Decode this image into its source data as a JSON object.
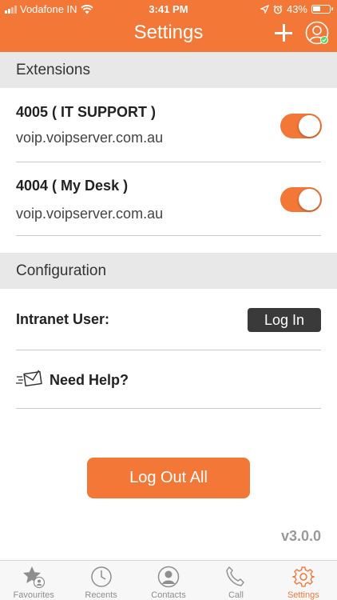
{
  "status_bar": {
    "carrier": "Vodafone IN",
    "time": "3:41 PM",
    "battery": "43%"
  },
  "header": {
    "title": "Settings"
  },
  "extensions": {
    "header": "Extensions",
    "items": [
      {
        "name": "4005 ( IT SUPPORT )",
        "server": "voip.voipserver.com.au",
        "enabled": true
      },
      {
        "name": "4004 ( My Desk )",
        "server": "voip.voipserver.com.au",
        "enabled": true
      }
    ]
  },
  "configuration": {
    "header": "Configuration",
    "intranet_label": "Intranet User:",
    "login_button": "Log In",
    "help_label": "Need Help?"
  },
  "logout_button": "Log Out All",
  "version": "v3.0.0",
  "tabs": [
    {
      "label": "Favourites",
      "icon": "star-icon",
      "active": false
    },
    {
      "label": "Recents",
      "icon": "clock-icon",
      "active": false
    },
    {
      "label": "Contacts",
      "icon": "person-icon",
      "active": false
    },
    {
      "label": "Call",
      "icon": "phone-icon",
      "active": false
    },
    {
      "label": "Settings",
      "icon": "gear-icon",
      "active": true
    }
  ],
  "colors": {
    "accent": "#f37737",
    "section_bg": "#e8e8e8",
    "dark_button": "#3a3a3a",
    "online": "#4cd964"
  }
}
